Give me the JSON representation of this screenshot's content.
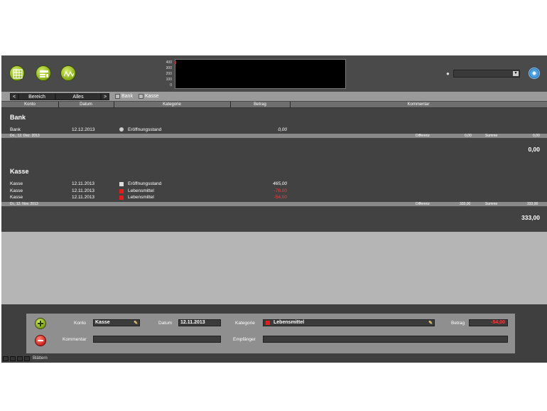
{
  "toolbar": {
    "buttons": [
      {
        "name": "table-view-icon"
      },
      {
        "name": "list-edit-icon"
      },
      {
        "name": "chart-view-icon"
      }
    ],
    "chart_ticks": [
      "400",
      "300",
      "200",
      "100",
      "0"
    ],
    "search_placeholder": ""
  },
  "filterbar": {
    "prev": "<",
    "range_label": "Bereich",
    "range_value": "Alles",
    "next": ">",
    "accounts": [
      "Bank",
      "Kasse"
    ]
  },
  "columns": [
    "Konto",
    "Datum",
    "Kategorie",
    "Betrag",
    "Kommentar"
  ],
  "groups": [
    {
      "title": "Bank",
      "rows": [
        {
          "konto": "Bank",
          "datum": "12.12.2013",
          "kategorie": "Eröffnungsstand",
          "betrag": "0,00",
          "negative": false,
          "color": "#cccccc",
          "shape": "circle"
        }
      ],
      "footer": {
        "date": "Do., 12. Dez. 2013",
        "diff_label": "Differenz",
        "diff": "0,00",
        "sum_label": "Summe",
        "sum": "0,00"
      },
      "total": "0,00"
    },
    {
      "title": "Kasse",
      "rows": [
        {
          "konto": "Kasse",
          "datum": "12.11.2013",
          "kategorie": "Eröffnungsstand",
          "betrag": "465,00",
          "negative": false,
          "color": "#dddddd",
          "shape": "square"
        },
        {
          "konto": "Kasse",
          "datum": "12.11.2013",
          "kategorie": "Lebensmittel",
          "betrag": "-78,00",
          "negative": true,
          "color": "#e01e1e",
          "shape": "square"
        },
        {
          "konto": "Kasse",
          "datum": "12.11.2013",
          "kategorie": "Lebensmittel",
          "betrag": "-54,00",
          "negative": true,
          "color": "#e01e1e",
          "shape": "square"
        }
      ],
      "footer": {
        "date": "Di., 12. Nov. 2013",
        "diff_label": "Differenz",
        "diff": "333,00",
        "sum_label": "Summe",
        "sum": "333,00"
      },
      "total": "333,00"
    }
  ],
  "editor": {
    "konto_label": "Konto",
    "konto_value": "Kasse",
    "datum_label": "Datum",
    "datum_value": "12.11.2013",
    "kategorie_label": "Kategorie",
    "kategorie_value": "Lebensmittel",
    "betrag_label": "Betrag",
    "betrag_value": "-54,00",
    "kommentar_label": "Kommentar",
    "kommentar_value": "",
    "empfaenger_label": "Empfänger",
    "empfaenger_value": ""
  },
  "statusbar": {
    "label": "Blättern"
  },
  "colors": {
    "accent_green": "#8ab01a",
    "negative": "#ff3a3a",
    "category_red": "#e01e1e"
  }
}
